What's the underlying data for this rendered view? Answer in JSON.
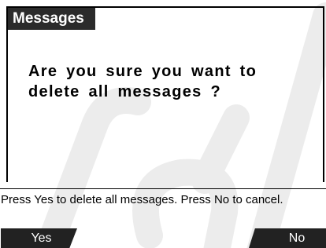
{
  "window": {
    "title": "Messages"
  },
  "dialog": {
    "question": "Are you sure you want to delete all messages ?"
  },
  "help": {
    "text": "Press Yes to delete all messages. Press No to cancel."
  },
  "softkeys": {
    "yes_label": "Yes",
    "no_label": "No"
  },
  "colors": {
    "title_bg": "#2b2b2b",
    "softkey_bg": "#222222",
    "watermark": "#ececec"
  }
}
